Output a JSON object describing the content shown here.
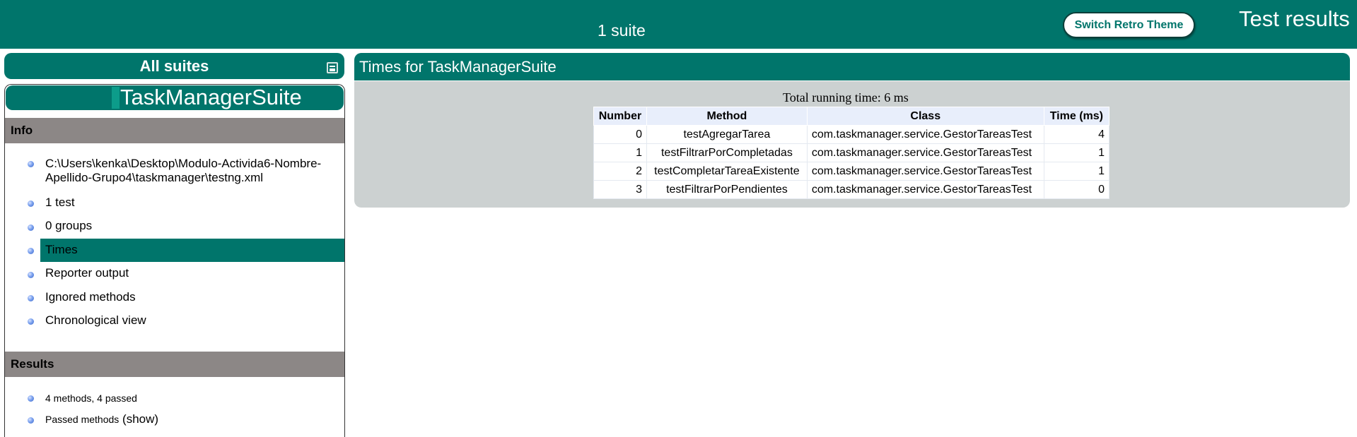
{
  "banner": {
    "suite_count": "1 suite",
    "retro_button": "Switch Retro Theme",
    "title": "Test results"
  },
  "navigator": {
    "all_suites": "All suites",
    "suite_name": "TaskManagerSuite",
    "info": {
      "heading": "Info",
      "items": [
        "C:\\Users\\kenka\\Desktop\\Modulo-Actividad6-Nombre-Apellido-Grupo4\\taskmanager\\testng.xml",
        "1 test",
        "0 groups",
        "Times",
        "Reporter output",
        "Ignored methods",
        "Chronological view"
      ],
      "path_line1": "C:\\Users\\kenka\\Desktop\\Modulo-Activida6-Nombre-",
      "path_line2": "Apellido-Grupo4\\taskmanager\\testng.xml",
      "selected": "Times"
    },
    "results": {
      "heading": "Results",
      "summary": "4 methods, 4 passed",
      "passed_label": "Passed methods",
      "show_link": "(show)"
    }
  },
  "main": {
    "header": "Times for TaskManagerSuite",
    "total_running_time": "Total running time: 6 ms",
    "columns": [
      "Number",
      "Method",
      "Class",
      "Time (ms)"
    ],
    "rows": [
      {
        "number": "0",
        "method": "testAgregarTarea",
        "class": "com.taskmanager.service.GestorTareasTest",
        "time": "4"
      },
      {
        "number": "1",
        "method": "testFiltrarPorCompletadas",
        "class": "com.taskmanager.service.GestorTareasTest",
        "time": "1"
      },
      {
        "number": "2",
        "method": "testCompletarTareaExistente",
        "class": "com.taskmanager.service.GestorTareasTest",
        "time": "1"
      },
      {
        "number": "3",
        "method": "testFiltrarPorPendientes",
        "class": "com.taskmanager.service.GestorTareasTest",
        "time": "0"
      }
    ]
  },
  "colors": {
    "accent": "#00756b",
    "section_head": "#8c8786",
    "panel_bg": "#ccd1d1"
  }
}
